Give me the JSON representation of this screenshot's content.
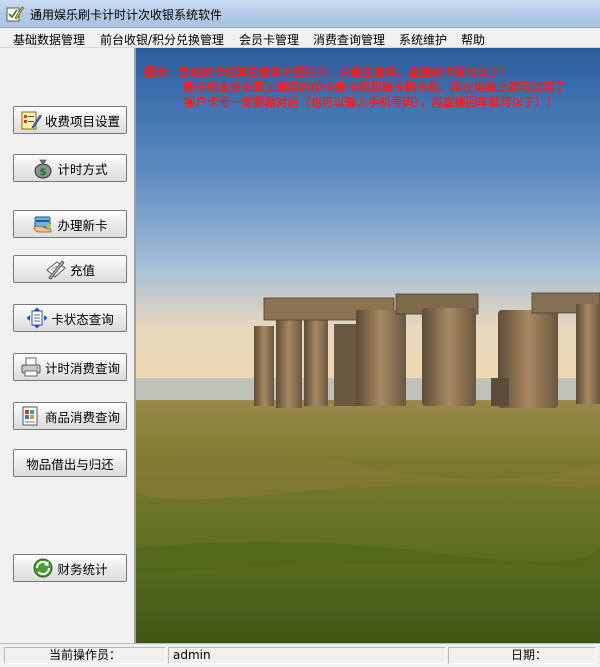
{
  "window": {
    "title": "通用娱乐刷卡计时计次收银系统软件",
    "app_icon": "pencil-check-icon"
  },
  "menu": {
    "items": [
      {
        "label": "基础数据管理"
      },
      {
        "label": "前台收银/积分兑换管理"
      },
      {
        "label": "会员卡管理"
      },
      {
        "label": "消费查询管理"
      },
      {
        "label": "系统维护"
      },
      {
        "label": "帮助"
      }
    ]
  },
  "sidebar": {
    "buttons": [
      {
        "label": "收费项目设置",
        "icon": "notepad-icon"
      },
      {
        "label": "计时方式",
        "icon": "money-bag-icon"
      },
      {
        "label": "办理新卡",
        "icon": "card-hand-icon"
      },
      {
        "label": "充值",
        "icon": "pen-paper-icon"
      },
      {
        "label": "卡状态查询",
        "icon": "arrows-document-icon"
      },
      {
        "label": "计时消费查询",
        "icon": "printer-icon"
      },
      {
        "label": "商品消费查询",
        "icon": "document-grid-icon"
      },
      {
        "label": "物品借出与归还",
        "icon": ""
      },
      {
        "label": "财务统计",
        "icon": "refresh-globe-icon"
      }
    ]
  },
  "tip": {
    "line1": "提示：自动刷卡时其它窗体不要打开，只留主窗体，直接刷卡就可以了！",
    "line2": "刷卡机支持市面上通用的ID卡刷卡机和磁卡刷卡机，接在电脑上就可以用了",
    "line3": "客户卡号一定要输对后（也可以输入手机号码），再直接回车就可以了）！",
    "color": "#ff1a1a"
  },
  "statusbar": {
    "operator_label": "当前操作员：",
    "operator_value": "admin",
    "date_label": "日期："
  }
}
